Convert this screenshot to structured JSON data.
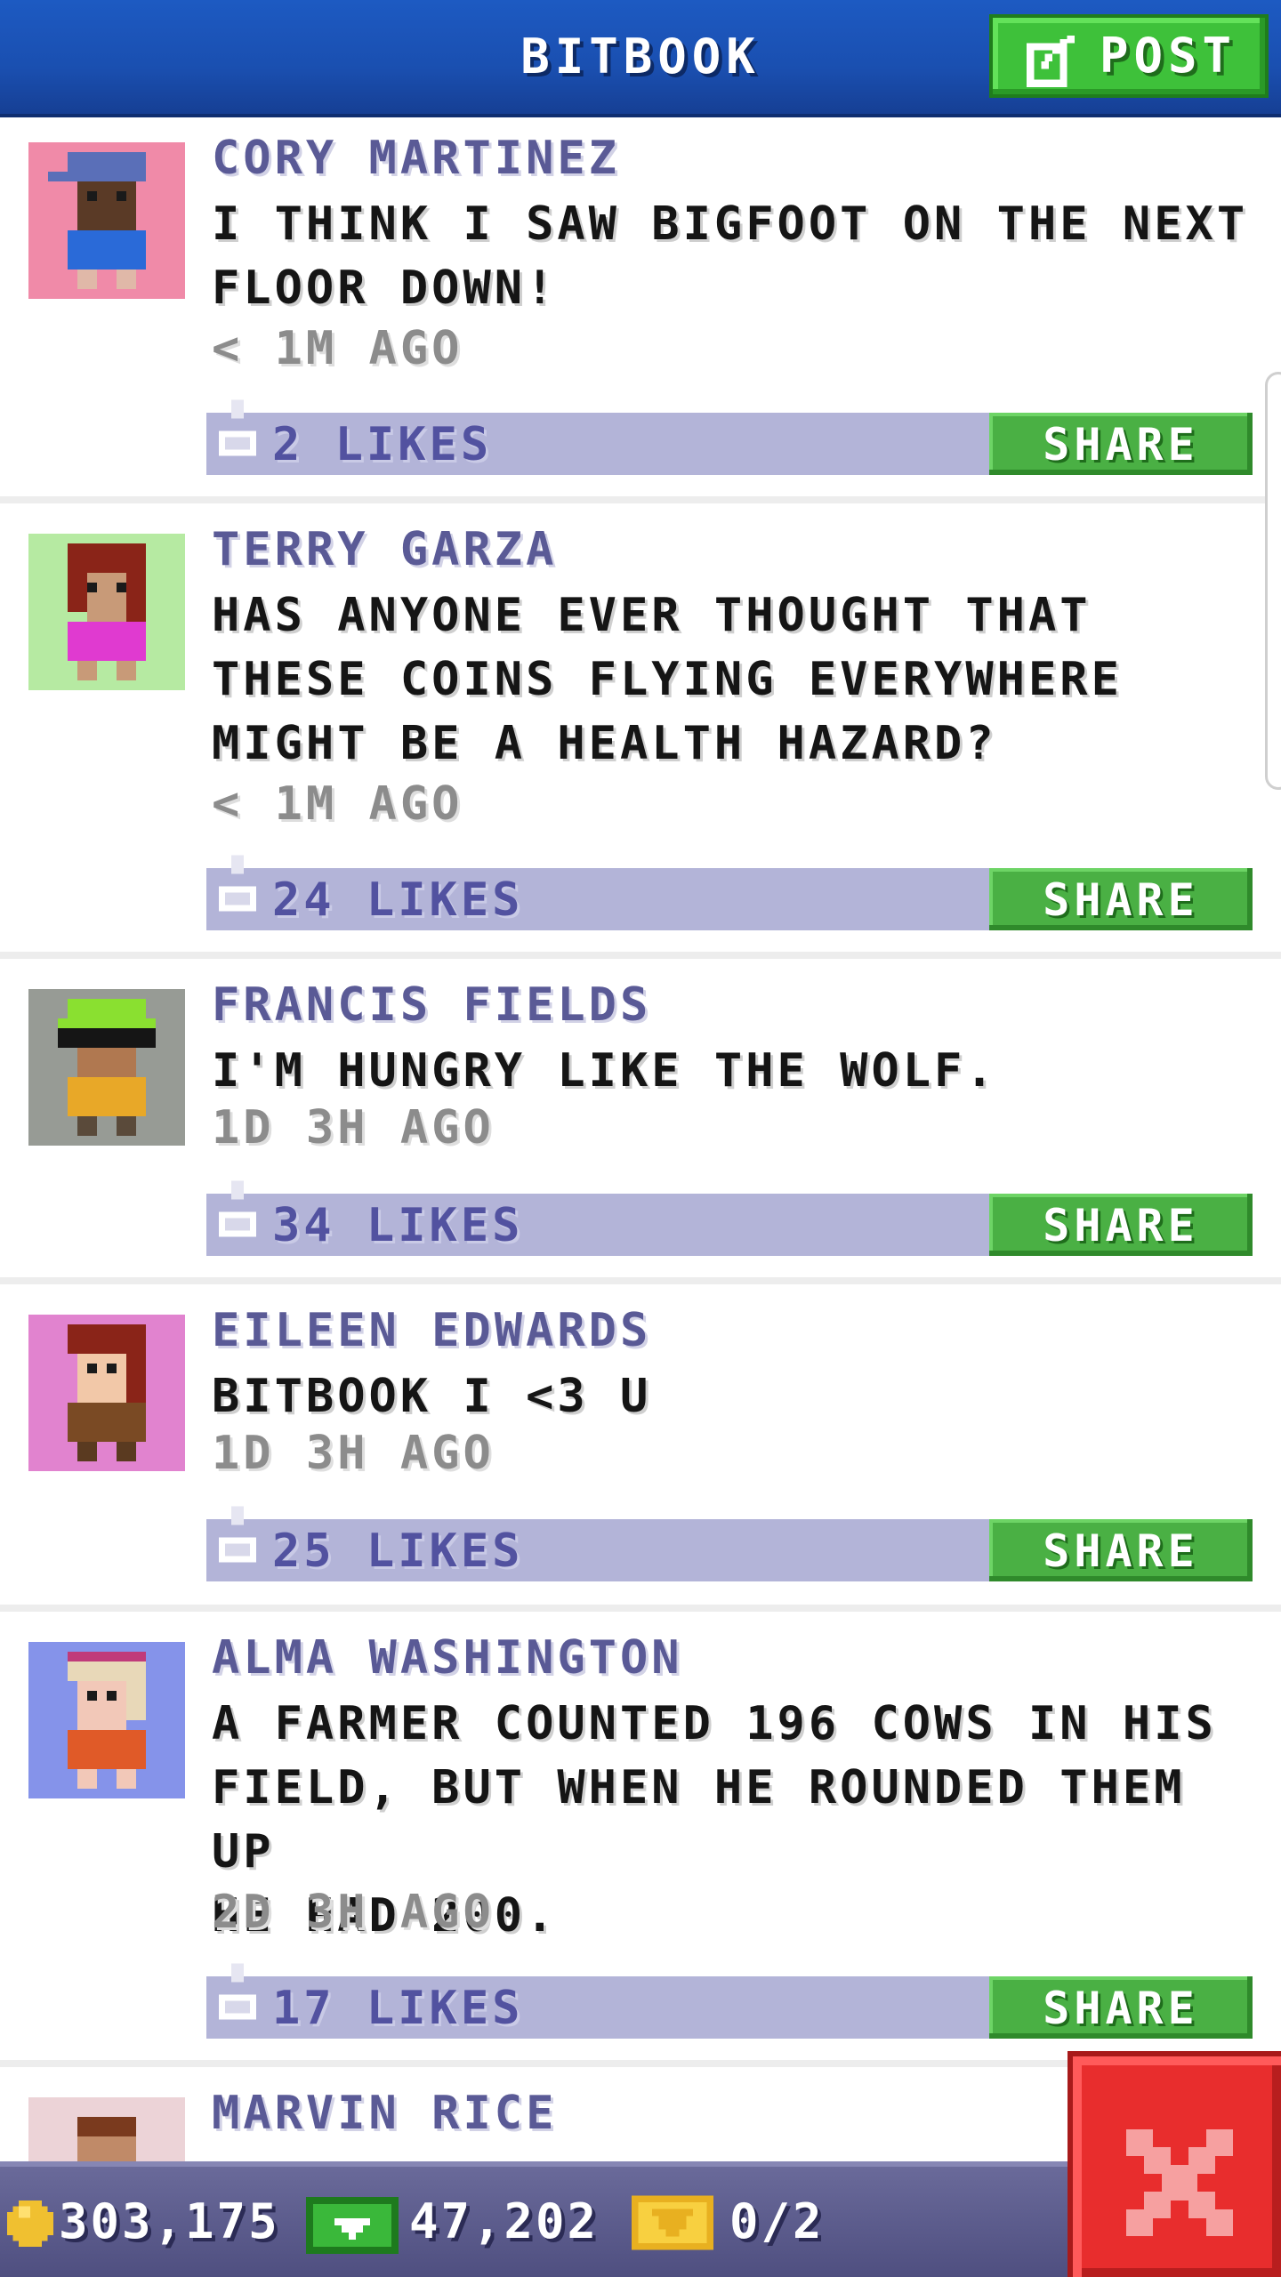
{
  "header": {
    "title": "BITBOOK",
    "post_label": "POST"
  },
  "colors": {
    "header_blue": "#1a4fb0",
    "post_green": "#3ec13a",
    "likes_bar": "#b3b4d8",
    "share_green": "#4ab044",
    "author_color": "#5a5a96",
    "close_red": "#e82d2d"
  },
  "posts": [
    {
      "author": "CORY MARTINEZ",
      "message": "I THINK I SAW BIGFOOT ON THE NEXT\nFLOOR DOWN!",
      "time": "< 1M AGO",
      "likes": "2 LIKES",
      "share": "SHARE",
      "avatar_bg": "#f08aa8"
    },
    {
      "author": "TERRY GARZA",
      "message": "HAS ANYONE EVER THOUGHT THAT\nTHESE COINS FLYING EVERYWHERE\nMIGHT BE A HEALTH HAZARD?",
      "time": "< 1M AGO",
      "likes": "24 LIKES",
      "share": "SHARE",
      "avatar_bg": "#b6eaa2"
    },
    {
      "author": "FRANCIS FIELDS",
      "message": "I'M HUNGRY LIKE THE WOLF.",
      "time": "1D 3H AGO",
      "likes": "34 LIKES",
      "share": "SHARE",
      "avatar_bg": "#979b95"
    },
    {
      "author": "EILEEN EDWARDS",
      "message": "BITBOOK I <3 U",
      "time": "1D 3H AGO",
      "likes": "25 LIKES",
      "share": "SHARE",
      "avatar_bg": "#e183cf"
    },
    {
      "author": "ALMA WASHINGTON",
      "message": "A FARMER COUNTED 196 COWS IN HIS\nFIELD, BUT WHEN HE ROUNDED THEM UP\nHE HAD 200.",
      "time": "2D 3H AGO",
      "likes": "17 LIKES",
      "share": "SHARE",
      "avatar_bg": "#8593ea"
    },
    {
      "author": "MARVIN RICE",
      "avatar_bg": "#ecd3d7"
    }
  ],
  "status": {
    "coins": "303,175",
    "bux": "47,202",
    "tickets": "0/2"
  }
}
